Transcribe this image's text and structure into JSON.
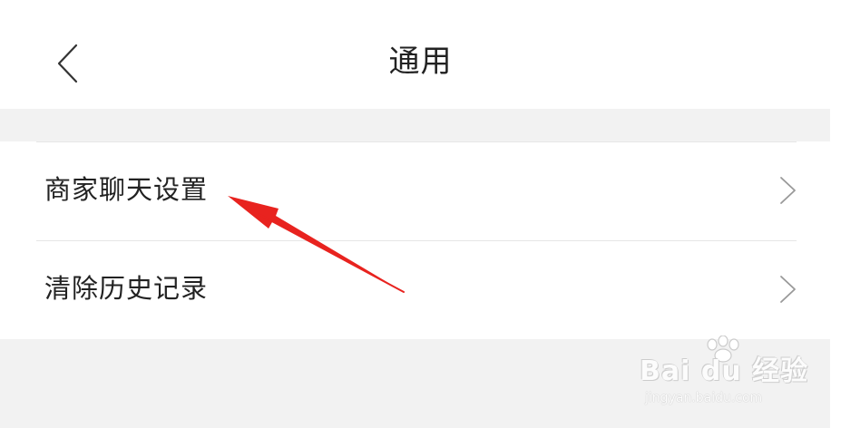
{
  "header": {
    "title": "通用",
    "back_icon": "chevron-left-icon"
  },
  "menu": {
    "items": [
      {
        "label": "商家聊天设置",
        "icon": "chevron-right-icon"
      },
      {
        "label": "清除历史记录",
        "icon": "chevron-right-icon"
      }
    ]
  },
  "watermark": {
    "brand": "Bai du 经验",
    "url": "jingyan.baidu.com"
  },
  "colors": {
    "background": "#ffffff",
    "section_gray": "#f2f2f2",
    "divider": "#e6e6e6",
    "text": "#222222",
    "chevron": "#999999",
    "annotation": "#e8231f"
  }
}
